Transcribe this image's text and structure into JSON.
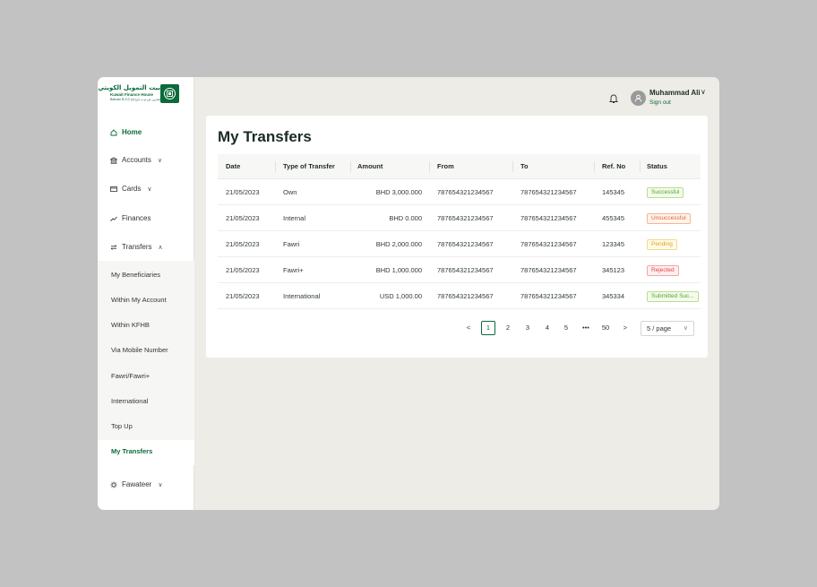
{
  "brand": {
    "arabic_name": "بيت التمويل الكويتي",
    "english_name": "Kuwait Finance House",
    "english_sub": "Bahrain B.S.C (c)  البحرين ش.م.ب (م)",
    "brand_color": "#0a6a3c"
  },
  "sidebar": {
    "items": [
      {
        "label": "Home",
        "icon": "home-icon"
      },
      {
        "label": "Accounts",
        "icon": "bank-icon"
      },
      {
        "label": "Cards",
        "icon": "card-icon"
      },
      {
        "label": "Finances",
        "icon": "trend-icon"
      },
      {
        "label": "Transfers",
        "icon": "transfer-icon"
      },
      {
        "label": "Fawateer",
        "icon": "fawateer-icon"
      }
    ],
    "sub_items": [
      "My Beneficiaries",
      "Within My Account",
      "Within KFHB",
      "Via Mobile Number",
      "Fawri/Fawri+",
      "International",
      "Top Up",
      "My Transfers"
    ],
    "active_sub": "My Transfers"
  },
  "header": {
    "user_name": "Muhammad Ali",
    "sign_out": "Sign out"
  },
  "main": {
    "title": "My Transfers",
    "columns": [
      "Date",
      "Type of Transfer",
      "Amount",
      "From",
      "To",
      "Ref. No",
      "Status"
    ],
    "rows": [
      {
        "date": "21/05/2023",
        "type": "Own",
        "amount": "BHD 3,000.000",
        "from": "787654321234567",
        "to": "787654321234567",
        "ref": "145345",
        "status": "Successful",
        "status_kind": "success"
      },
      {
        "date": "21/05/2023",
        "type": "Internal",
        "amount": "BHD 0.000",
        "from": "787654321234567",
        "to": "787654321234567",
        "ref": "455345",
        "status": "Unsuccessful",
        "status_kind": "unsuccess"
      },
      {
        "date": "21/05/2023",
        "type": "Fawri",
        "amount": "BHD 2,000.000",
        "from": "787654321234567",
        "to": "787654321234567",
        "ref": "123345",
        "status": "Pending",
        "status_kind": "pending"
      },
      {
        "date": "21/05/2023",
        "type": "Fawri+",
        "amount": "BHD 1,000.000",
        "from": "787654321234567",
        "to": "787654321234567",
        "ref": "345123",
        "status": "Rejected",
        "status_kind": "rejected"
      },
      {
        "date": "21/05/2023",
        "type": "International",
        "amount": "USD 1,000.00",
        "from": "787654321234567",
        "to": "787654321234567",
        "ref": "345334",
        "status": "Submitted Suc...",
        "status_kind": "success"
      }
    ]
  },
  "pagination": {
    "pages": [
      "1",
      "2",
      "3",
      "4",
      "5"
    ],
    "ellipsis": "•••",
    "last_page": "50",
    "current_page": "1",
    "page_size": "5 / page",
    "prev": "<",
    "next": ">"
  }
}
